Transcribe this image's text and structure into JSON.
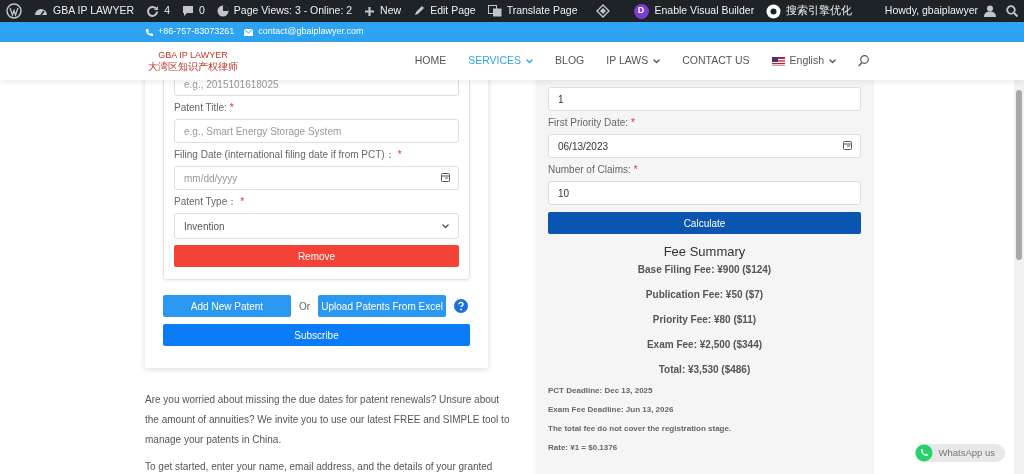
{
  "admin_bar": {
    "site": "GBA IP LAWYER",
    "updates": "4",
    "comments": "0",
    "page_views": "Page Views: 3 - Online: 2",
    "new": "New",
    "edit": "Edit Page",
    "translate": "Translate Page",
    "builder_badge": "D",
    "builder": "Enable Visual Builder",
    "seo": "搜索引擎优化",
    "howdy": "Howdy, gbaiplawyer"
  },
  "contact_bar": {
    "phone": "+86-757-83073261",
    "email": "contact@gbaiplawyer.com"
  },
  "header": {
    "logo_en": "GBA IP LAWYER",
    "logo_cn": "大湾区知识产权律师",
    "menu": [
      {
        "label": "HOME",
        "selected": false,
        "dropdown": false
      },
      {
        "label": "SERVICES",
        "selected": true,
        "dropdown": true
      },
      {
        "label": "BLOG",
        "selected": false,
        "dropdown": false
      },
      {
        "label": "IP LAWS",
        "selected": false,
        "dropdown": true
      },
      {
        "label": "CONTACT US",
        "selected": false,
        "dropdown": false
      }
    ],
    "language": "English"
  },
  "patent_form": {
    "fields": [
      {
        "kind": "text",
        "placeholder": "e.g., 2015101618025"
      },
      {
        "kind": "text",
        "label": "Patent Title:",
        "required_mark": "*",
        "placeholder": "e.g., Smart Energy Storage System"
      },
      {
        "kind": "date",
        "label": "Filing Date (international filing date if from PCT)：",
        "required_mark": "*",
        "placeholder": "mm/dd/yyyy"
      },
      {
        "kind": "select",
        "label": "Patent Type：",
        "required_mark": "*",
        "value": "Invention"
      }
    ],
    "remove": "Remove",
    "add": "Add New Patent",
    "or": "Or",
    "upload": "Upload Patents From Excel",
    "subscribe": "Subscribe"
  },
  "fee_calculator": {
    "fields": [
      {
        "kind": "text",
        "value": "1"
      },
      {
        "kind": "date",
        "label": "First Priority Date:",
        "required_mark": "*",
        "value": "06/13/2023"
      },
      {
        "kind": "text",
        "label": "Number of Claims:",
        "required_mark": "*",
        "value": "10"
      }
    ],
    "calculate": "Calculate",
    "summary_title": "Fee Summary",
    "fees": [
      "Base Filing Fee: ¥900 ($124)",
      "Publication Fee: ¥50 ($7)",
      "Priority Fee: ¥80 ($11)",
      "Exam Fee: ¥2,500 ($344)",
      "Total: ¥3,530 ($486)"
    ],
    "notes": [
      "PCT Deadline: Dec 13, 2025",
      "Exam Fee Deadline: Jun 13, 2026",
      "The total fee do not cover the registration stage.",
      "Rate: ¥1 = $0.1376"
    ]
  },
  "intro": [
    "Are you worried about missing the due dates for patent renewals? Unsure about the amount of annuities? We invite you to use our latest FREE and SIMPLE tool to manage your patents in China.",
    "To get started, enter your name, email address, and the details of your granted"
  ],
  "whatsapp": "WhatsApp us"
}
